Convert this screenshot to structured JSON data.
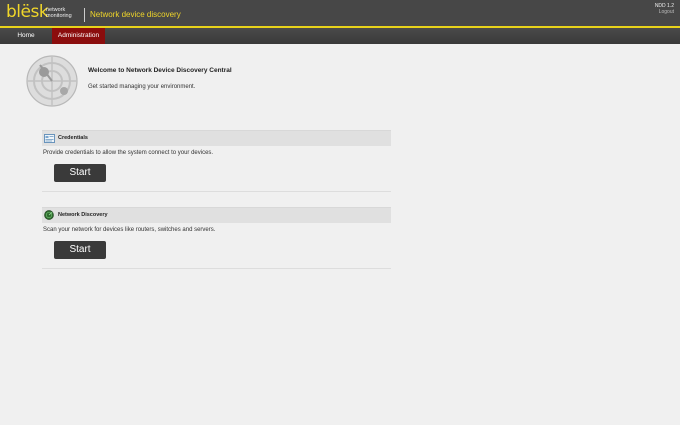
{
  "header": {
    "logo_text": "blësk",
    "logo_sub": "network monitoring",
    "app_title": "Network device discovery",
    "version": "NDD 1.2",
    "logout": "Logout"
  },
  "nav": {
    "items": [
      {
        "label": "Home"
      },
      {
        "label": "Administration",
        "active": true
      }
    ]
  },
  "welcome": {
    "title": "Welcome to Network Device Discovery Central",
    "subtitle": "Get started managing your environment."
  },
  "sections": [
    {
      "title": "Credentials",
      "description": "Provide credentials to allow the system connect to your devices.",
      "button": "Start",
      "icon": "credentials-icon"
    },
    {
      "title": "Network Discovery",
      "description": "Scan your network for devices like routers, switches and servers.",
      "button": "Start",
      "icon": "network-discovery-icon"
    }
  ],
  "colors": {
    "header_bg": "#474747",
    "accent_yellow": "#e8d21a",
    "active_tab": "#8b0d0d",
    "button_bg": "#3a3a3a"
  }
}
